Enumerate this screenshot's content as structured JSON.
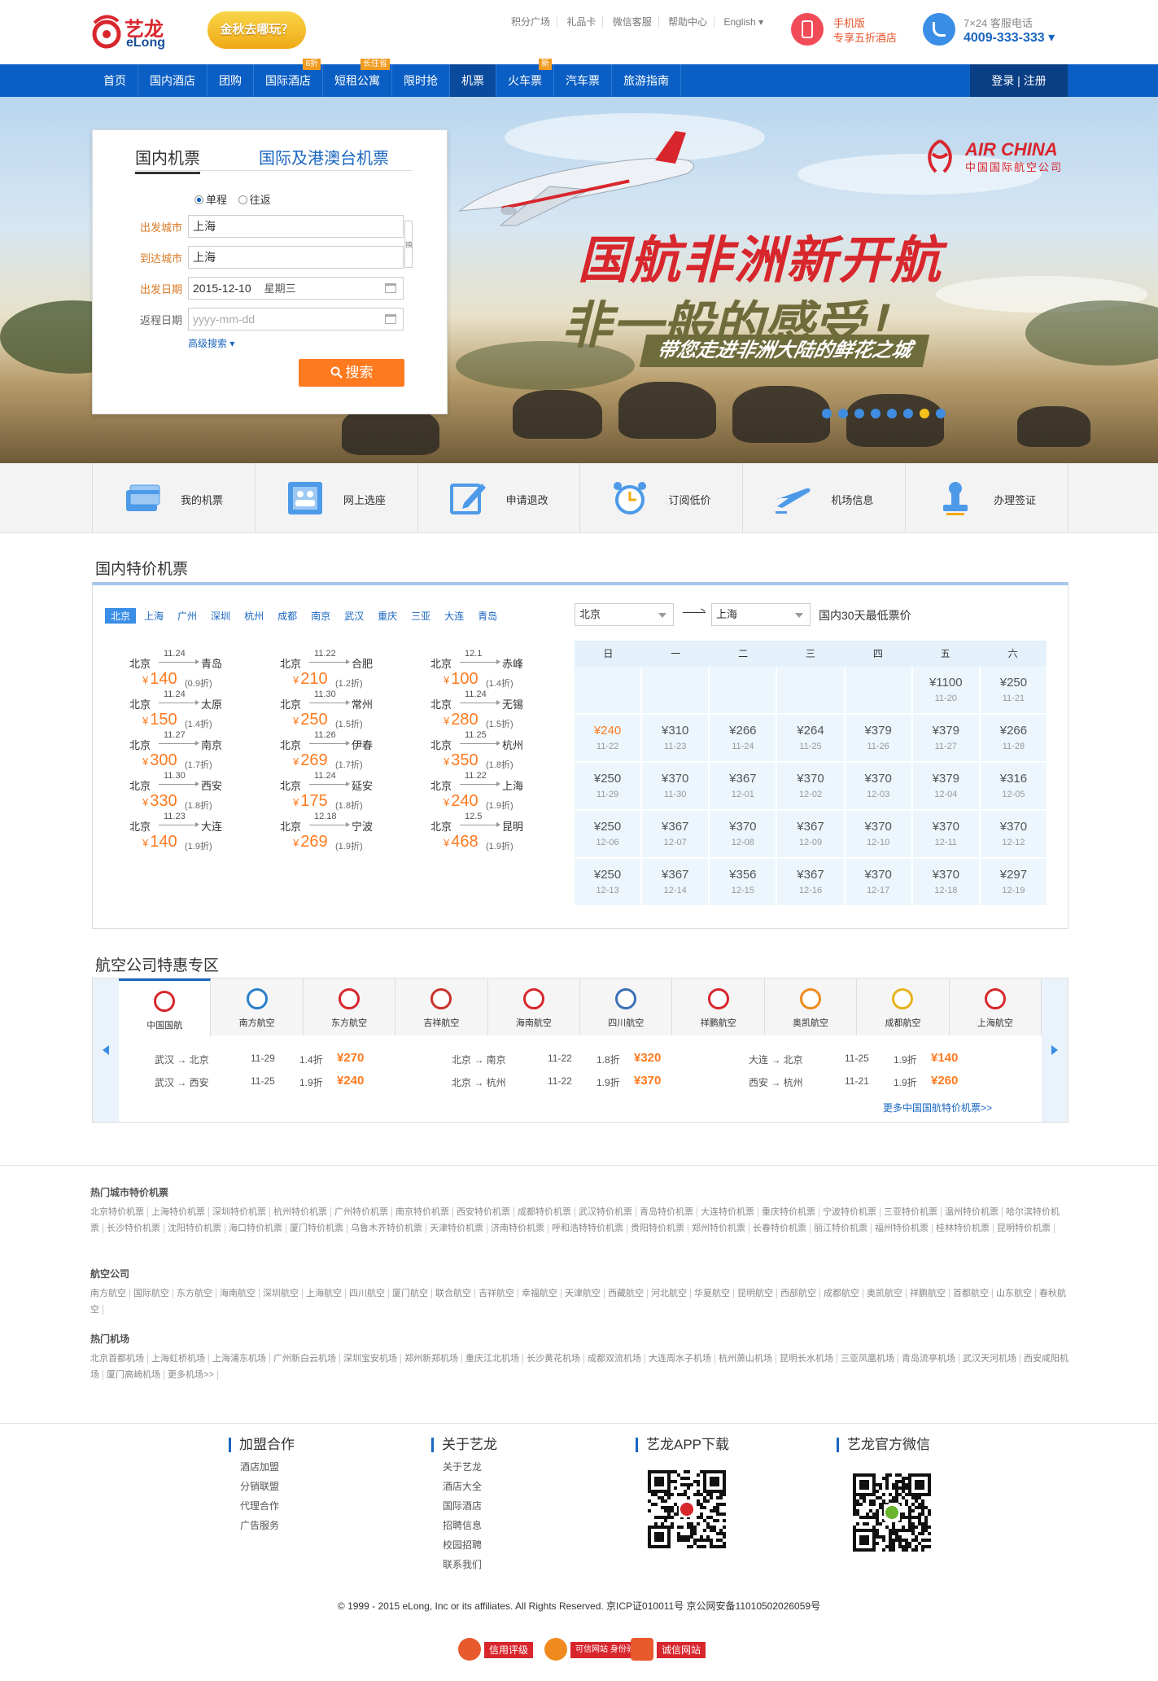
{
  "header": {
    "logo_cn": "艺龙",
    "logo_en": "eLong",
    "promo": "金秋去哪玩？",
    "top_links": [
      "积分广场",
      "礼品卡",
      "微信客服",
      "帮助中心",
      "English ▾"
    ],
    "mobile_line1": "手机版",
    "mobile_line2": "专享五折酒店",
    "tel_label": "7×24 客服电话",
    "tel_number": "4009-333-333 ▾"
  },
  "nav": {
    "items": [
      {
        "label": "首页",
        "tag": ""
      },
      {
        "label": "国内酒店",
        "tag": ""
      },
      {
        "label": "团购",
        "tag": ""
      },
      {
        "label": "国际酒店",
        "tag": "8折"
      },
      {
        "label": "短租公寓",
        "tag": "长住省"
      },
      {
        "label": "限时抢",
        "tag": ""
      },
      {
        "label": "机票",
        "tag": ""
      },
      {
        "label": "火车票",
        "tag": "新"
      },
      {
        "label": "汽车票",
        "tag": ""
      },
      {
        "label": "旅游指南",
        "tag": ""
      }
    ],
    "login": "登录 | 注册"
  },
  "banner": {
    "slogan1": "国航非洲新开航",
    "slogan2": "非一般的感受！",
    "slogan3": "带您走进非洲大陆的鲜花之城",
    "airline_en": "AIR CHINA",
    "airline_cn": "中国国际航空公司",
    "slides": 8,
    "active_slide": 7
  },
  "search": {
    "tab_domestic": "国内机票",
    "tab_intl": "国际及港澳台机票",
    "oneway": "单程",
    "roundtrip": "往返",
    "from_label": "出发城市",
    "from_value": "上海",
    "to_label": "到达城市",
    "to_value": "上海",
    "swap": "换",
    "depart_label": "出发日期",
    "depart_value": "2015-12-10",
    "depart_weekday": "星期三",
    "return_label": "返程日期",
    "return_placeholder": "yyyy-mm-dd",
    "advanced": "高级搜索 ▾",
    "button": "搜索"
  },
  "services": [
    "我的机票",
    "网上选座",
    "申请退改",
    "订阅低价",
    "机场信息",
    "办理签证"
  ],
  "domestic": {
    "title": "国内特价机票",
    "cities": [
      "北京",
      "上海",
      "广州",
      "深圳",
      "杭州",
      "成都",
      "南京",
      "武汉",
      "重庆",
      "三亚",
      "大连",
      "青岛"
    ],
    "deals": [
      {
        "from": "北京",
        "to": "青岛",
        "date": "11.24",
        "price": "140",
        "discount": "(0.9折)"
      },
      {
        "from": "北京",
        "to": "合肥",
        "date": "11.22",
        "price": "210",
        "discount": "(1.2折)"
      },
      {
        "from": "北京",
        "to": "赤峰",
        "date": "12.1",
        "price": "100",
        "discount": "(1.4折)"
      },
      {
        "from": "北京",
        "to": "太原",
        "date": "11.24",
        "price": "150",
        "discount": "(1.4折)"
      },
      {
        "from": "北京",
        "to": "常州",
        "date": "11.30",
        "price": "250",
        "discount": "(1.5折)"
      },
      {
        "from": "北京",
        "to": "无锡",
        "date": "11.24",
        "price": "280",
        "discount": "(1.5折)"
      },
      {
        "from": "北京",
        "to": "南京",
        "date": "11.27",
        "price": "300",
        "discount": "(1.7折)"
      },
      {
        "from": "北京",
        "to": "伊春",
        "date": "11.26",
        "price": "269",
        "discount": "(1.7折)"
      },
      {
        "from": "北京",
        "to": "杭州",
        "date": "11.25",
        "price": "350",
        "discount": "(1.8折)"
      },
      {
        "from": "北京",
        "to": "西安",
        "date": "11.30",
        "price": "330",
        "discount": "(1.8折)"
      },
      {
        "from": "北京",
        "to": "延安",
        "date": "11.24",
        "price": "175",
        "discount": "(1.8折)"
      },
      {
        "from": "北京",
        "to": "上海",
        "date": "11.22",
        "price": "240",
        "discount": "(1.9折)"
      },
      {
        "from": "北京",
        "to": "大连",
        "date": "11.23",
        "price": "140",
        "discount": "(1.9折)"
      },
      {
        "from": "北京",
        "to": "宁波",
        "date": "12.18",
        "price": "269",
        "discount": "(1.9折)"
      },
      {
        "from": "北京",
        "to": "昆明",
        "date": "12.5",
        "price": "468",
        "discount": "(1.9折)"
      }
    ],
    "currency": "¥",
    "cal_from": "北京",
    "cal_to": "上海",
    "cal_title": "国内30天最低票价",
    "weekdays": [
      "日",
      "一",
      "二",
      "三",
      "四",
      "五",
      "六"
    ],
    "calendar": [
      {
        "p": "",
        "d": ""
      },
      {
        "p": "",
        "d": ""
      },
      {
        "p": "",
        "d": ""
      },
      {
        "p": "",
        "d": ""
      },
      {
        "p": "",
        "d": ""
      },
      {
        "p": "¥1100",
        "d": "11-20"
      },
      {
        "p": "¥250",
        "d": "11-21"
      },
      {
        "p": "¥240",
        "d": "11-22",
        "hi": true
      },
      {
        "p": "¥310",
        "d": "11-23"
      },
      {
        "p": "¥266",
        "d": "11-24"
      },
      {
        "p": "¥264",
        "d": "11-25"
      },
      {
        "p": "¥379",
        "d": "11-26"
      },
      {
        "p": "¥379",
        "d": "11-27"
      },
      {
        "p": "¥266",
        "d": "11-28"
      },
      {
        "p": "¥250",
        "d": "11-29"
      },
      {
        "p": "¥370",
        "d": "11-30"
      },
      {
        "p": "¥367",
        "d": "12-01"
      },
      {
        "p": "¥370",
        "d": "12-02"
      },
      {
        "p": "¥370",
        "d": "12-03"
      },
      {
        "p": "¥379",
        "d": "12-04"
      },
      {
        "p": "¥316",
        "d": "12-05"
      },
      {
        "p": "¥250",
        "d": "12-06"
      },
      {
        "p": "¥367",
        "d": "12-07"
      },
      {
        "p": "¥370",
        "d": "12-08"
      },
      {
        "p": "¥367",
        "d": "12-09"
      },
      {
        "p": "¥370",
        "d": "12-10"
      },
      {
        "p": "¥370",
        "d": "12-11"
      },
      {
        "p": "¥370",
        "d": "12-12"
      },
      {
        "p": "¥250",
        "d": "12-13"
      },
      {
        "p": "¥367",
        "d": "12-14"
      },
      {
        "p": "¥356",
        "d": "12-15"
      },
      {
        "p": "¥367",
        "d": "12-16"
      },
      {
        "p": "¥370",
        "d": "12-17"
      },
      {
        "p": "¥370",
        "d": "12-18"
      },
      {
        "p": "¥297",
        "d": "12-19"
      }
    ]
  },
  "airlines": {
    "title": "航空公司特惠专区",
    "tabs": [
      {
        "name": "中国国航",
        "color": "#d8262d"
      },
      {
        "name": "南方航空",
        "color": "#2a7fc9"
      },
      {
        "name": "东方航空",
        "color": "#d8262d"
      },
      {
        "name": "吉祥航空",
        "color": "#c8322a"
      },
      {
        "name": "海南航空",
        "color": "#d8262d"
      },
      {
        "name": "四川航空",
        "color": "#3a6fb5"
      },
      {
        "name": "祥鹏航空",
        "color": "#d8262d"
      },
      {
        "name": "奥凯航空",
        "color": "#f08a1f"
      },
      {
        "name": "成都航空",
        "color": "#e6b21e"
      },
      {
        "name": "上海航空",
        "color": "#d8262d"
      }
    ],
    "rows": [
      {
        "route": "武汉 → 北京",
        "date": "11-29",
        "disc": "1.4折",
        "price": "¥270"
      },
      {
        "route": "北京 → 南京",
        "date": "11-22",
        "disc": "1.8折",
        "price": "¥320"
      },
      {
        "route": "大连 → 北京",
        "date": "11-25",
        "disc": "1.9折",
        "price": "¥140"
      },
      {
        "route": "武汉 → 西安",
        "date": "11-25",
        "disc": "1.9折",
        "price": "¥240"
      },
      {
        "route": "北京 → 杭州",
        "date": "11-22",
        "disc": "1.9折",
        "price": "¥370"
      },
      {
        "route": "西安 → 杭州",
        "date": "11-21",
        "disc": "1.9折",
        "price": "¥260"
      }
    ],
    "more": "更多中国国航特价机票>>"
  },
  "hot_cities": {
    "title": "热门城市特价机票",
    "links": [
      "北京特价机票",
      "上海特价机票",
      "深圳特价机票",
      "杭州特价机票",
      "广州特价机票",
      "南京特价机票",
      "西安特价机票",
      "成都特价机票",
      "武汉特价机票",
      "青岛特价机票",
      "大连特价机票",
      "重庆特价机票",
      "宁波特价机票",
      "三亚特价机票",
      "温州特价机票",
      "哈尔滨特价机票",
      "长沙特价机票",
      "沈阳特价机票",
      "海口特价机票",
      "厦门特价机票",
      "乌鲁木齐特价机票",
      "天津特价机票",
      "济南特价机票",
      "呼和浩特特价机票",
      "贵阳特价机票",
      "郑州特价机票",
      "长春特价机票",
      "丽江特价机票",
      "福州特价机票",
      "桂林特价机票",
      "昆明特价机票"
    ]
  },
  "hot_airlines": {
    "title": "航空公司",
    "links": [
      "南方航空",
      "国际航空",
      "东方航空",
      "海南航空",
      "深圳航空",
      "上海航空",
      "四川航空",
      "厦门航空",
      "联合航空",
      "吉祥航空",
      "幸福航空",
      "天津航空",
      "西藏航空",
      "河北航空",
      "华夏航空",
      "昆明航空",
      "西部航空",
      "成都航空",
      "奥凯航空",
      "祥鹏航空",
      "首都航空",
      "山东航空",
      "春秋航空"
    ]
  },
  "hot_airports": {
    "title": "热门机场",
    "links": [
      "北京首都机场",
      "上海虹桥机场",
      "上海浦东机场",
      "广州新白云机场",
      "深圳宝安机场",
      "郑州新郑机场",
      "重庆江北机场",
      "长沙黄花机场",
      "成都双流机场",
      "大连周水子机场",
      "杭州萧山机场",
      "昆明长水机场",
      "三亚凤凰机场",
      "青岛流亭机场",
      "武汉天河机场",
      "西安咸阳机场",
      "厦门高崎机场",
      "更多机场>>"
    ]
  },
  "footer": {
    "col1_title": "加盟合作",
    "col1_links": [
      "酒店加盟",
      "分销联盟",
      "代理合作",
      "广告服务"
    ],
    "col2_title": "关于艺龙",
    "col2_links": [
      "关于艺龙",
      "酒店大全",
      "国际酒店",
      "招聘信息",
      "校园招聘",
      "联系我们"
    ],
    "col3_title": "艺龙APP下载",
    "col4_title": "艺龙官方微信",
    "copyright": "© 1999 - 2015 eLong, Inc or its affiliates. All Rights Reserved. 京ICP证010011号 京公网安备11010502026059号",
    "badges": [
      "信用评级",
      "可信网站 身份验证",
      "诚信网站"
    ]
  }
}
